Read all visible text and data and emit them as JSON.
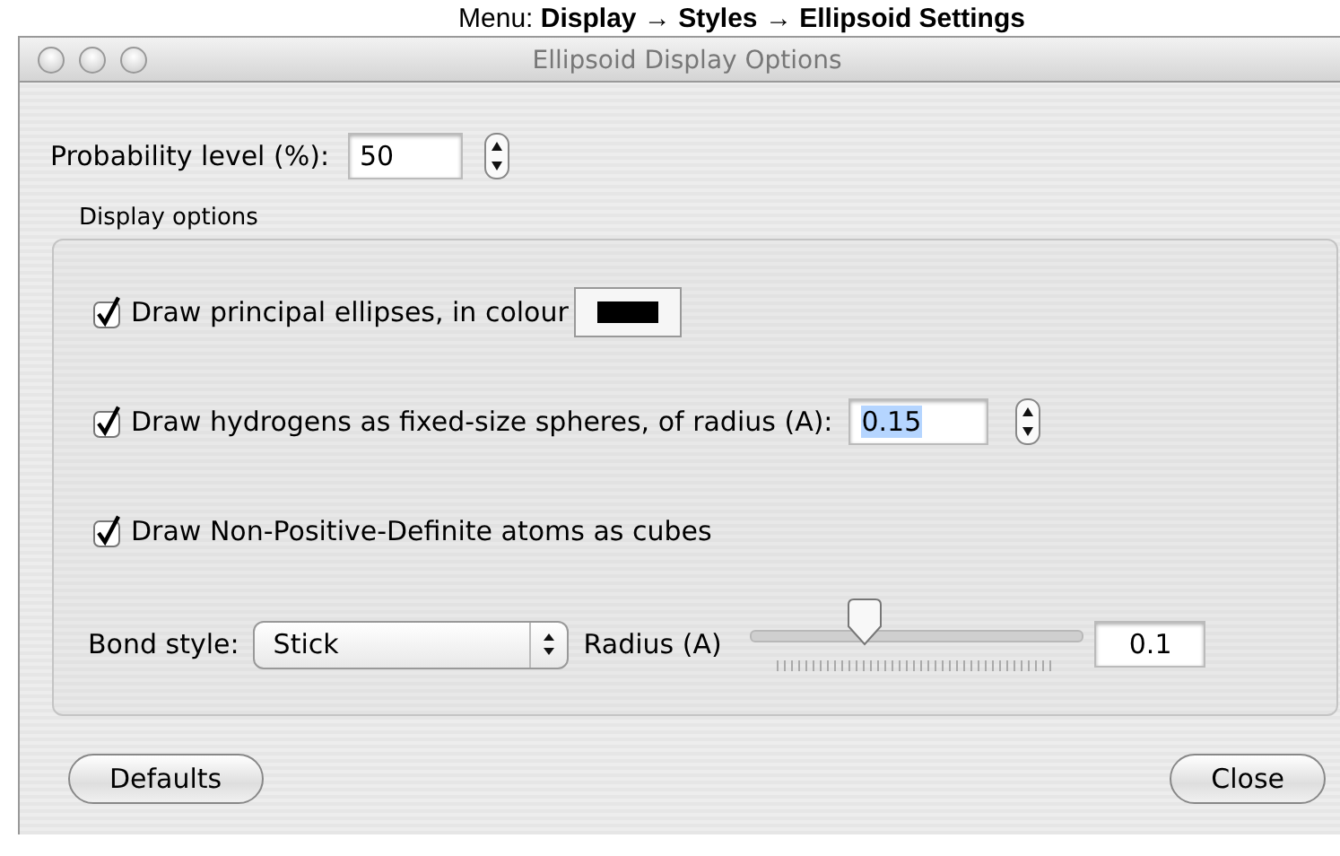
{
  "caption": "Menu: **Display → Styles → Ellipsoid Settings**",
  "window": {
    "title": "Ellipsoid Display Options"
  },
  "probability": {
    "label": "Probability level (%):",
    "value": "50"
  },
  "display_options": {
    "title": "Display options",
    "options": [
      {
        "kind": "color",
        "label": "Draw principal ellipses, in colour",
        "checked": true,
        "color": "#000000"
      },
      {
        "kind": "number",
        "label": "Draw hydrogens as fixed-size spheres, of radius (A):",
        "checked": true,
        "value": "0.15",
        "highlighted": true
      },
      {
        "kind": "plain",
        "label": "Draw Non-Positive-Definite atoms as cubes",
        "checked": true
      }
    ],
    "bond": {
      "label": "Bond style:",
      "style": "Stick",
      "radius_label": "Radius (A)",
      "level": 0.34,
      "radius": "0.1"
    }
  },
  "buttons": [
    {
      "label": "Defaults"
    },
    {
      "label": "Close"
    }
  ]
}
